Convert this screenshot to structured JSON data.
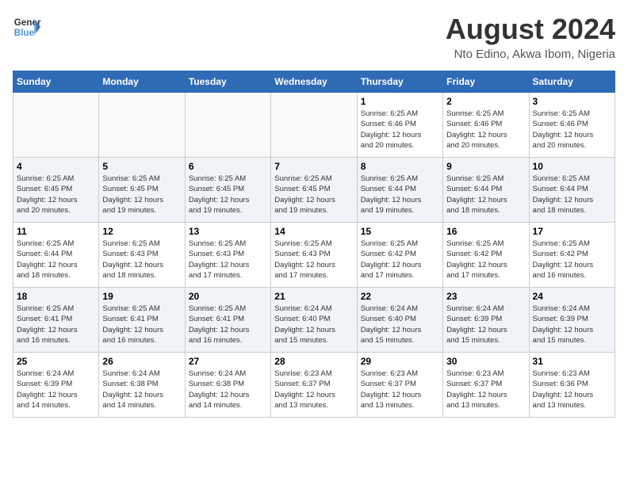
{
  "header": {
    "logo_line1": "General",
    "logo_line2": "Blue",
    "main_title": "August 2024",
    "subtitle": "Nto Edino, Akwa Ibom, Nigeria"
  },
  "weekdays": [
    "Sunday",
    "Monday",
    "Tuesday",
    "Wednesday",
    "Thursday",
    "Friday",
    "Saturday"
  ],
  "weeks": [
    [
      {
        "day": "",
        "info": ""
      },
      {
        "day": "",
        "info": ""
      },
      {
        "day": "",
        "info": ""
      },
      {
        "day": "",
        "info": ""
      },
      {
        "day": "1",
        "info": "Sunrise: 6:25 AM\nSunset: 6:46 PM\nDaylight: 12 hours\nand 20 minutes."
      },
      {
        "day": "2",
        "info": "Sunrise: 6:25 AM\nSunset: 6:46 PM\nDaylight: 12 hours\nand 20 minutes."
      },
      {
        "day": "3",
        "info": "Sunrise: 6:25 AM\nSunset: 6:46 PM\nDaylight: 12 hours\nand 20 minutes."
      }
    ],
    [
      {
        "day": "4",
        "info": "Sunrise: 6:25 AM\nSunset: 6:45 PM\nDaylight: 12 hours\nand 20 minutes."
      },
      {
        "day": "5",
        "info": "Sunrise: 6:25 AM\nSunset: 6:45 PM\nDaylight: 12 hours\nand 19 minutes."
      },
      {
        "day": "6",
        "info": "Sunrise: 6:25 AM\nSunset: 6:45 PM\nDaylight: 12 hours\nand 19 minutes."
      },
      {
        "day": "7",
        "info": "Sunrise: 6:25 AM\nSunset: 6:45 PM\nDaylight: 12 hours\nand 19 minutes."
      },
      {
        "day": "8",
        "info": "Sunrise: 6:25 AM\nSunset: 6:44 PM\nDaylight: 12 hours\nand 19 minutes."
      },
      {
        "day": "9",
        "info": "Sunrise: 6:25 AM\nSunset: 6:44 PM\nDaylight: 12 hours\nand 18 minutes."
      },
      {
        "day": "10",
        "info": "Sunrise: 6:25 AM\nSunset: 6:44 PM\nDaylight: 12 hours\nand 18 minutes."
      }
    ],
    [
      {
        "day": "11",
        "info": "Sunrise: 6:25 AM\nSunset: 6:44 PM\nDaylight: 12 hours\nand 18 minutes."
      },
      {
        "day": "12",
        "info": "Sunrise: 6:25 AM\nSunset: 6:43 PM\nDaylight: 12 hours\nand 18 minutes."
      },
      {
        "day": "13",
        "info": "Sunrise: 6:25 AM\nSunset: 6:43 PM\nDaylight: 12 hours\nand 17 minutes."
      },
      {
        "day": "14",
        "info": "Sunrise: 6:25 AM\nSunset: 6:43 PM\nDaylight: 12 hours\nand 17 minutes."
      },
      {
        "day": "15",
        "info": "Sunrise: 6:25 AM\nSunset: 6:42 PM\nDaylight: 12 hours\nand 17 minutes."
      },
      {
        "day": "16",
        "info": "Sunrise: 6:25 AM\nSunset: 6:42 PM\nDaylight: 12 hours\nand 17 minutes."
      },
      {
        "day": "17",
        "info": "Sunrise: 6:25 AM\nSunset: 6:42 PM\nDaylight: 12 hours\nand 16 minutes."
      }
    ],
    [
      {
        "day": "18",
        "info": "Sunrise: 6:25 AM\nSunset: 6:41 PM\nDaylight: 12 hours\nand 16 minutes."
      },
      {
        "day": "19",
        "info": "Sunrise: 6:25 AM\nSunset: 6:41 PM\nDaylight: 12 hours\nand 16 minutes."
      },
      {
        "day": "20",
        "info": "Sunrise: 6:25 AM\nSunset: 6:41 PM\nDaylight: 12 hours\nand 16 minutes."
      },
      {
        "day": "21",
        "info": "Sunrise: 6:24 AM\nSunset: 6:40 PM\nDaylight: 12 hours\nand 15 minutes."
      },
      {
        "day": "22",
        "info": "Sunrise: 6:24 AM\nSunset: 6:40 PM\nDaylight: 12 hours\nand 15 minutes."
      },
      {
        "day": "23",
        "info": "Sunrise: 6:24 AM\nSunset: 6:39 PM\nDaylight: 12 hours\nand 15 minutes."
      },
      {
        "day": "24",
        "info": "Sunrise: 6:24 AM\nSunset: 6:39 PM\nDaylight: 12 hours\nand 15 minutes."
      }
    ],
    [
      {
        "day": "25",
        "info": "Sunrise: 6:24 AM\nSunset: 6:39 PM\nDaylight: 12 hours\nand 14 minutes."
      },
      {
        "day": "26",
        "info": "Sunrise: 6:24 AM\nSunset: 6:38 PM\nDaylight: 12 hours\nand 14 minutes."
      },
      {
        "day": "27",
        "info": "Sunrise: 6:24 AM\nSunset: 6:38 PM\nDaylight: 12 hours\nand 14 minutes."
      },
      {
        "day": "28",
        "info": "Sunrise: 6:23 AM\nSunset: 6:37 PM\nDaylight: 12 hours\nand 13 minutes."
      },
      {
        "day": "29",
        "info": "Sunrise: 6:23 AM\nSunset: 6:37 PM\nDaylight: 12 hours\nand 13 minutes."
      },
      {
        "day": "30",
        "info": "Sunrise: 6:23 AM\nSunset: 6:37 PM\nDaylight: 12 hours\nand 13 minutes."
      },
      {
        "day": "31",
        "info": "Sunrise: 6:23 AM\nSunset: 6:36 PM\nDaylight: 12 hours\nand 13 minutes."
      }
    ]
  ]
}
